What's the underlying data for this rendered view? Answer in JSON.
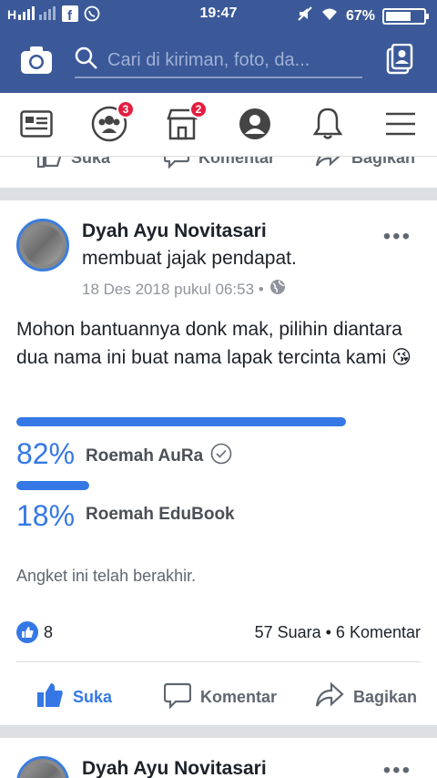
{
  "status": {
    "time": "19:47",
    "battery": "67%"
  },
  "search": {
    "placeholder": "Cari di kiriman, foto, da..."
  },
  "nav": {
    "friends_badge": "3",
    "marketplace_badge": "2"
  },
  "prev_post": {
    "like_label": "Suka",
    "comment_label": "Komentar",
    "share_label": "Bagikan"
  },
  "post": {
    "author": "Dyah Ayu Novitasari",
    "action": "membuat jajak pendapat.",
    "timestamp": "18 Des 2018 pukul 06:53 •",
    "text": "Mohon bantuannya donk mak, pilihin diantara dua nama ini buat nama lapak tercinta kami 😘",
    "poll": {
      "options": [
        {
          "percent": "82%",
          "value": 82,
          "label": "Roemah AuRa",
          "selected": true
        },
        {
          "percent": "18%",
          "value": 18,
          "label": "Roemah EduBook",
          "selected": false
        }
      ],
      "ended_text": "Angket ini telah berakhir."
    },
    "likes": "8",
    "counts": "57 Suara • 6 Komentar",
    "like_label": "Suka",
    "comment_label": "Komentar",
    "share_label": "Bagikan"
  },
  "next_post": {
    "author": "Dyah Ayu Novitasari"
  },
  "colors": {
    "brand": "#3b5998",
    "accent": "#3578e5",
    "badge": "#e41e3f"
  }
}
